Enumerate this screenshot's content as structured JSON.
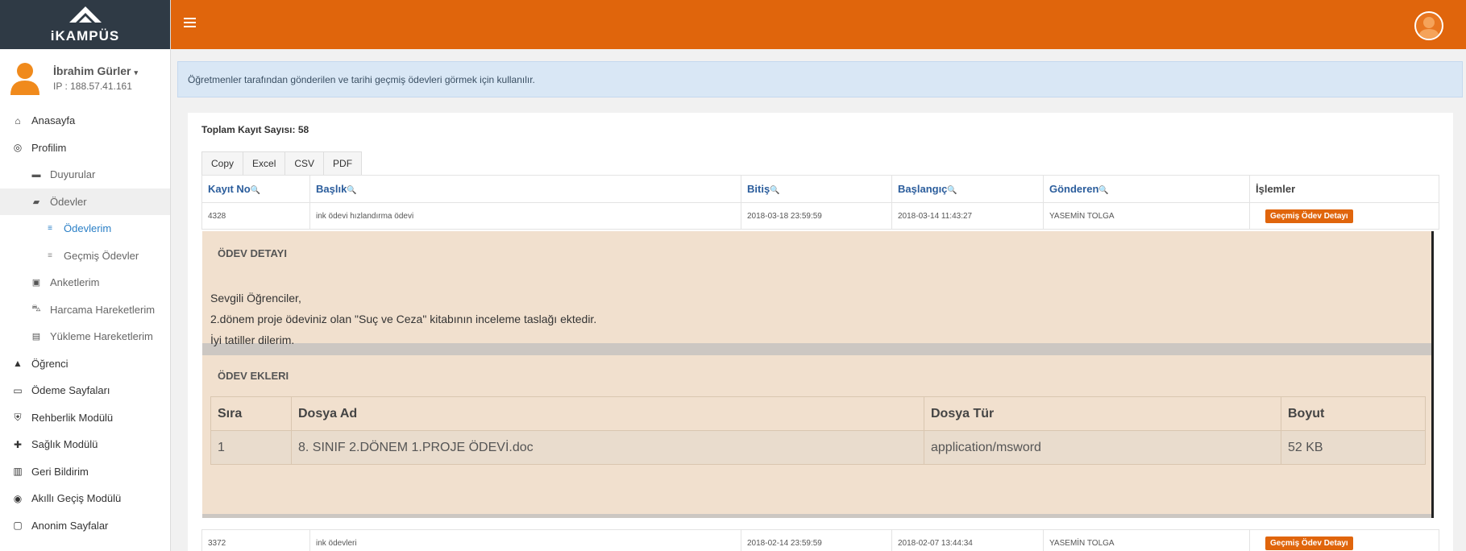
{
  "logo": {
    "text": "iKAMPÜS"
  },
  "user": {
    "name": "İbrahim Gürler",
    "caret": "▾",
    "ip": "IP : 188.57.41.161"
  },
  "menu": [
    {
      "label": "Anasayfa",
      "icon": "home-icon",
      "glyph": "⌂",
      "level": 0
    },
    {
      "label": "Profilim",
      "icon": "user-circle-icon",
      "glyph": "◎",
      "level": 0
    },
    {
      "label": "Duyurular",
      "icon": "comment-icon",
      "glyph": "▬",
      "level": 1
    },
    {
      "label": "Ödevler",
      "icon": "briefcase-icon",
      "glyph": "▰",
      "level": 1
    },
    {
      "label": "Ödevlerim",
      "icon": "list-icon",
      "glyph": "≡",
      "level": 2
    },
    {
      "label": "Geçmiş Ödevler",
      "icon": "list-icon",
      "glyph": "≡",
      "level": 2
    },
    {
      "label": "Anketlerim",
      "icon": "clipboard-icon",
      "glyph": "▣",
      "level": 1
    },
    {
      "label": "Harcama Hareketlerim",
      "icon": "cart-icon",
      "glyph": "⛍",
      "level": 1
    },
    {
      "label": "Yükleme Hareketlerim",
      "icon": "wallet-icon",
      "glyph": "▤",
      "level": 1
    },
    {
      "label": "Öğrenci",
      "icon": "graduation-cap-icon",
      "glyph": "▲",
      "level": 0
    },
    {
      "label": "Ödeme Sayfaları",
      "icon": "credit-card-icon",
      "glyph": "▭",
      "level": 0
    },
    {
      "label": "Rehberlik Modülü",
      "icon": "shield-icon",
      "glyph": "⛨",
      "level": 0
    },
    {
      "label": "Sağlık Modülü",
      "icon": "medkit-icon",
      "glyph": "✚",
      "level": 0
    },
    {
      "label": "Geri Bildirim",
      "icon": "book-icon",
      "glyph": "▥",
      "level": 0
    },
    {
      "label": "Akıllı Geçiş Modülü",
      "icon": "compass-icon",
      "glyph": "◉",
      "level": 0
    },
    {
      "label": "Anonim Sayfalar",
      "icon": "expand-icon",
      "glyph": "▢",
      "level": 0
    }
  ],
  "info": "Öğretmenler tarafından gönderilen ve tarihi geçmiş ödevleri görmek için kullanılır.",
  "total_label": "Toplam Kayıt Sayısı: 58",
  "export_buttons": [
    "Copy",
    "Excel",
    "CSV",
    "PDF"
  ],
  "table": {
    "columns": [
      "Kayıt No",
      "Başlık",
      "Bitiş",
      "Başlangıç",
      "Gönderen",
      "İşlemler"
    ],
    "search_glyph": "🔍",
    "rows": [
      {
        "id": "4328",
        "title": "ink ödevi hızlandırma ödevi",
        "end": "2018-03-18 23:59:59",
        "start": "2018-03-14 11:43:27",
        "sender": "YASEMİN TOLGA",
        "action": "Geçmiş Ödev Detayı"
      },
      {
        "id": "3372",
        "title": "ink ödevleri",
        "end": "2018-02-14 23:59:59",
        "start": "2018-02-07 13:44:34",
        "sender": "YASEMİN TOLGA",
        "action": "Geçmiş Ödev Detayı"
      }
    ]
  },
  "detail": {
    "title": "ÖDEV DETAYI",
    "lines": [
      "Sevgili Öğrenciler,",
      "2.dönem proje ödeviniz olan \"Suç ve Ceza\" kitabının inceleme taslağı ektedir.",
      "İyi tatiller dilerim."
    ],
    "attachments_title": "ÖDEV EKLERI",
    "attach_columns": [
      "Sıra",
      "Dosya Ad",
      "Dosya Tür",
      "Boyut"
    ],
    "attachments": [
      {
        "no": "1",
        "name": "8. SINIF 2.DÖNEM 1.PROJE ÖDEVİ.doc",
        "type": "application/msword",
        "size": "52 KB"
      }
    ]
  },
  "colors": {
    "topbar": "#e0650c",
    "sidebar_logo": "#2f3a45",
    "info_bg": "#d9e7f5",
    "detail_bg": "#f1e0ce",
    "link": "#2b5d9c"
  }
}
